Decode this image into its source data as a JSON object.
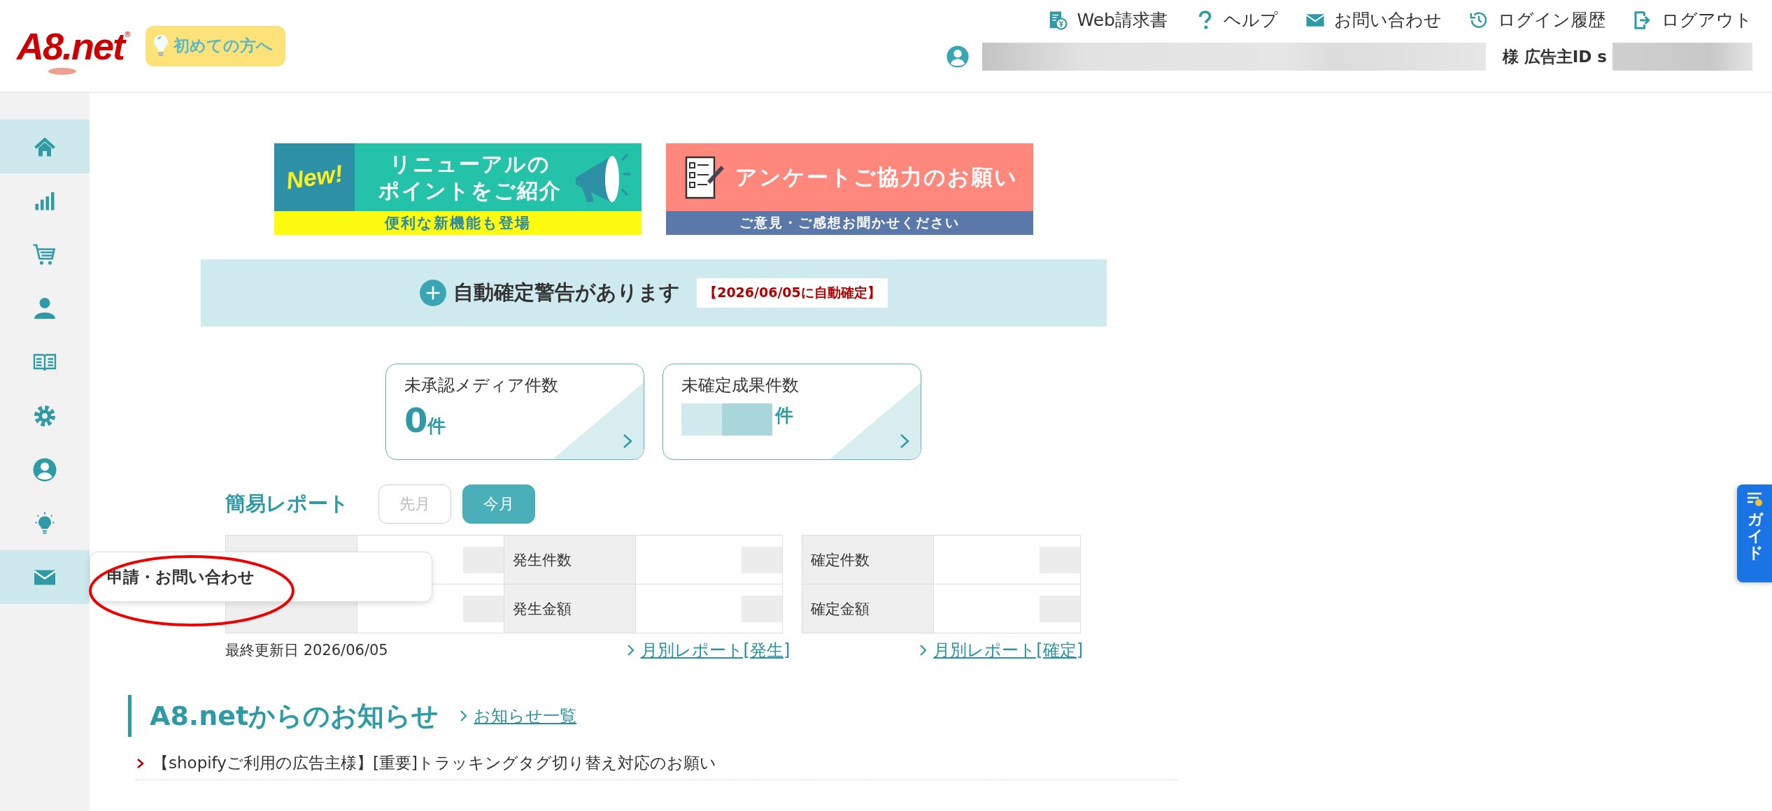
{
  "header": {
    "logo": "A8.net",
    "logo_mark": "®",
    "beginner_button": "初めての方へ",
    "nav": [
      {
        "kind": "invoice",
        "label": "Web請求書"
      },
      {
        "kind": "help",
        "label": "ヘルプ"
      },
      {
        "kind": "mail",
        "label": "お問い合わせ"
      },
      {
        "kind": "history",
        "label": "ログイン履歴"
      },
      {
        "kind": "logout",
        "label": "ログアウト"
      }
    ],
    "user": {
      "honorific": "様",
      "id_label": "広告主ID s"
    }
  },
  "sidebar": [
    {
      "kind": "home",
      "selected": true
    },
    {
      "kind": "chart",
      "selected": false
    },
    {
      "kind": "cart",
      "selected": false
    },
    {
      "kind": "person",
      "selected": false
    },
    {
      "kind": "book",
      "selected": false
    },
    {
      "kind": "gear",
      "selected": false
    },
    {
      "kind": "account",
      "selected": false
    },
    {
      "kind": "bulb",
      "selected": false
    },
    {
      "kind": "mail",
      "selected": true
    }
  ],
  "tooltip": "申請・お問い合わせ",
  "banners": [
    {
      "kind": "renewal",
      "badge": "New!",
      "title_lines": [
        "リニューアルの",
        "ポイントをご紹介"
      ],
      "subtitle": "便利な新機能も登場"
    },
    {
      "kind": "survey",
      "title": "アンケートご協力のお願い",
      "subtitle": "ご意見・ご感想お聞かせください"
    }
  ],
  "alert": {
    "text": "自動確定警告があります",
    "badge": "【2026/06/05に自動確定】"
  },
  "cards": [
    {
      "title": "未承認メディア件数",
      "value": "0",
      "unit": "件",
      "redacted": false
    },
    {
      "title": "未確定成果件数",
      "unit": "件",
      "redacted": true
    }
  ],
  "report": {
    "title": "簡易レポート",
    "periods": [
      {
        "label": "先月",
        "selected": false
      },
      {
        "label": "今月",
        "selected": true
      }
    ],
    "tables": [
      {
        "rows": [
          [
            {
              "kind": "covered"
            },
            {
              "kind": "label",
              "label": "発生件数"
            }
          ],
          [
            {
              "kind": "covered"
            },
            {
              "kind": "label",
              "label": "発生金額"
            }
          ]
        ]
      },
      {
        "rows": [
          [
            {
              "kind": "label",
              "label": "確定件数"
            }
          ],
          [
            {
              "kind": "label",
              "label": "確定金額"
            }
          ]
        ]
      }
    ],
    "updated": "最終更新日 2026/06/05",
    "links": [
      "月別レポート[発生]",
      "月別レポート[確定]"
    ]
  },
  "news": {
    "title": "A8.netからのお知らせ",
    "more_link": "お知らせ一覧",
    "items": [
      "【shopifyご利用の広告主様】[重要]トラッキングタグ切り替え対応のお願い"
    ]
  },
  "guide_tab": "ガイド"
}
